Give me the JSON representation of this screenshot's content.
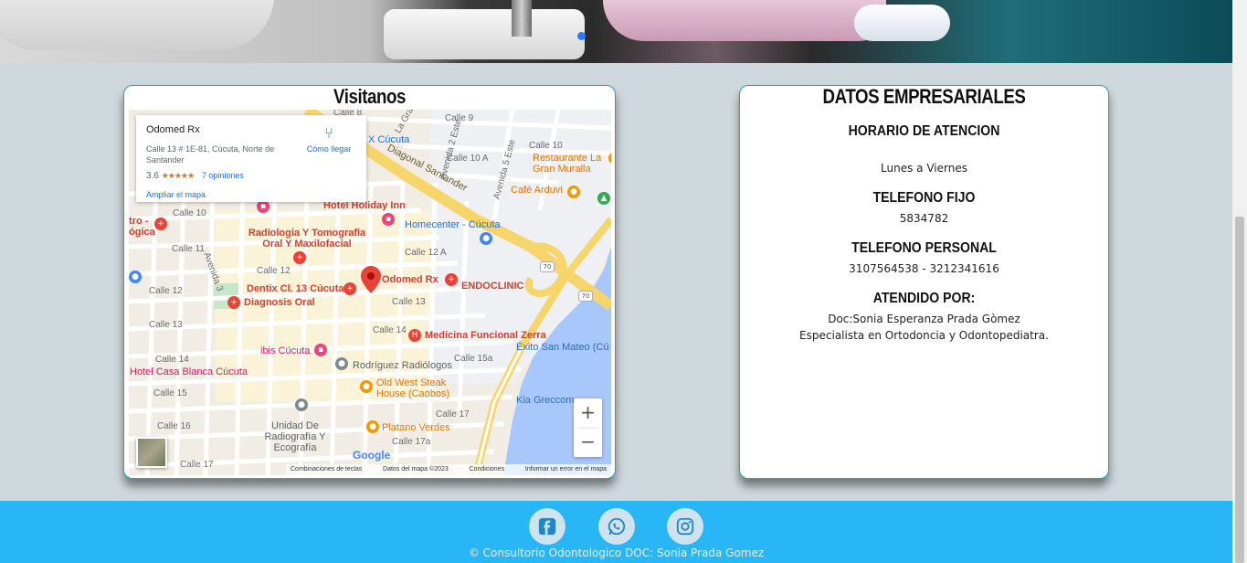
{
  "map_section": {
    "title": "Visitanos",
    "info_window": {
      "place_name": "Odomed Rx",
      "address": "Calle 13 # 1E-81, Cúcuta, Norte de Santander",
      "rating": "3.6",
      "stars": "★★★★★",
      "reviews": "7 opiniones",
      "enlarge": "Ampliar el mapa",
      "directions": "Cómo llegar"
    },
    "places": {
      "holiday_inn": "Hotel Holiday Inn",
      "homecenter": "Homecenter - Cúcuta",
      "radiologia": "Radiologia Y Tomografia Oral Y Maxilofacial",
      "dentix": "Dentix Cl. 13 Cúcuta",
      "odomed": "Odomed Rx",
      "endoclinic": "ENDOCLINIC",
      "diagnosis": "Diagnosis Oral",
      "medicina": "Medicina Funcional Zerra",
      "ibis": "ibis Cúcuta",
      "casa_blanca": "Hotel Casa Blanca Cúcuta",
      "rodriguez": "Rodríguez Radiólogos",
      "old_west": "Old West Steak House (Caobos)",
      "unidad": "Unidad De Radiografía Y Ecografía",
      "platano": "Platano Verdes",
      "restaurante": "Restaurante La Gran Muralla",
      "cafe": "Café Arduvi",
      "exito": "Éxito San Mateo (Cú",
      "kia": "Kia Greccom",
      "cucuta": "X Cúcuta",
      "tro": "tro - ógica"
    },
    "streets": {
      "calle8": "Calle 8",
      "calle9": "Calle 9",
      "calle10": "Calle 10",
      "calle10a": "Calle 10 A",
      "calle11": "Calle 11",
      "calle12": "Calle 12",
      "calle12a": "Calle 12 A",
      "calle13": "Calle 13",
      "calle14": "Calle 14",
      "calle15": "Calle 15",
      "calle15a": "Calle 15a",
      "calle16": "Calle 16",
      "calle17": "Calle 17",
      "calle17a": "Calle 17a",
      "calle10b": "Calle 10",
      "calle14b": "Calle 14",
      "diagonal": "Diagonal Santander",
      "av2este": "Avenida 2 Este",
      "av5este": "Avenida 5 Este",
      "avenida3": "Avenida 3",
      "la_gran": "La Gran",
      "route70a": "70",
      "route70b": "70"
    },
    "google": "Google",
    "attribution": {
      "shortcuts": "Combinaciones de teclas",
      "map_data": "Datos del mapa ©2023",
      "terms": "Condiciones",
      "report": "Informar un error en el mapa"
    },
    "zoom_in": "+",
    "zoom_out": "−"
  },
  "business": {
    "title": "DATOS EMPRESARIALES",
    "schedule_heading": "HORARIO DE ATENCION",
    "schedule": "Lunes a Viernes",
    "landline_heading": "TELEFONO FIJO",
    "landline": "5834782",
    "mobile_heading": "TELEFONO PERSONAL",
    "mobile": "3107564538 - 3212341616",
    "attended_heading": "ATENDIDO POR:",
    "doctor": "Doc:Sonia Esperanza Prada Gòmez",
    "specialty": "Especialista en Ortodoncia y Odontopediatra."
  },
  "footer": {
    "copyright": "© Consultorio Odontologico DOC: Sonia Prada Gomez",
    "icons": [
      "facebook-icon",
      "whatsapp-icon",
      "instagram-icon"
    ]
  },
  "colors": {
    "footer_bg": "#29b6f6",
    "card_border": "#1ea5c9",
    "page_bg": "#cfd8dc"
  }
}
